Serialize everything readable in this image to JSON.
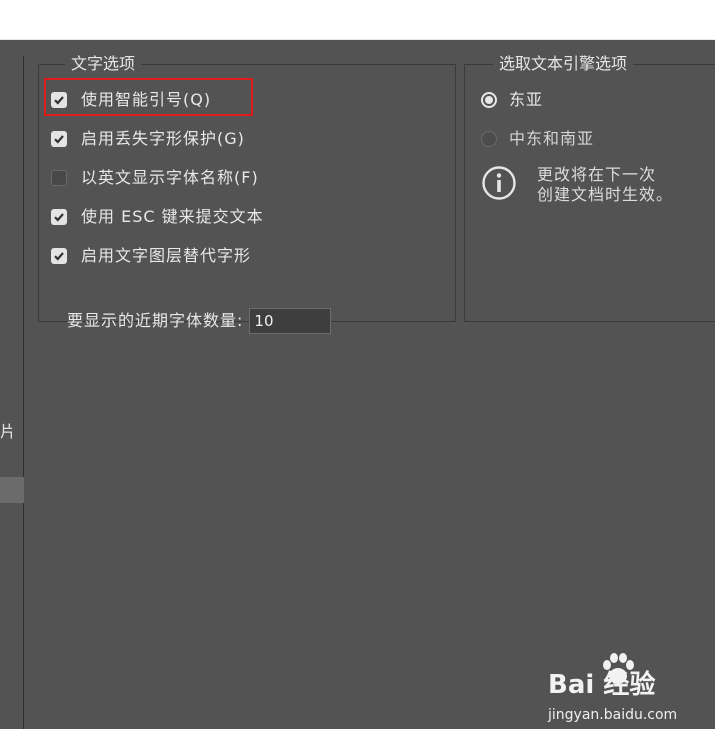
{
  "text_options": {
    "title": "文字选项",
    "checkboxes": [
      {
        "label": "使用智能引号(Q)",
        "checked": true
      },
      {
        "label": "启用丢失字形保护(G)",
        "checked": true
      },
      {
        "label": "以英文显示字体名称(F)",
        "checked": false
      },
      {
        "label": "使用 ESC 键来提交文本",
        "checked": true
      },
      {
        "label": "启用文字图层替代字形",
        "checked": true
      }
    ],
    "recent_fonts_label": "要显示的近期字体数量:",
    "recent_fonts_value": "10"
  },
  "engine_options": {
    "title": "选取文本引擎选项",
    "radios": [
      {
        "label": "东亚",
        "selected": true
      },
      {
        "label": "中东和南亚",
        "selected": false
      }
    ],
    "info_lines": [
      "更改将在下一次",
      "创建文档时生效。"
    ]
  },
  "left_nav": {
    "partial_char": "片"
  },
  "watermark": {
    "main": "Bai 经验",
    "sub": "jingyan.baidu.com"
  },
  "colors": {
    "dialog_bg": "#535353",
    "highlight": "#e01b1b"
  }
}
